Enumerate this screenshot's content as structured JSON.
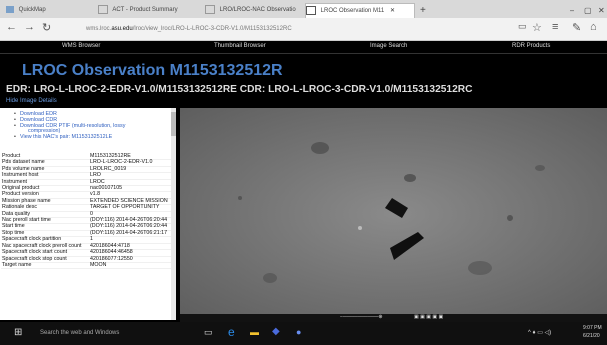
{
  "browser": {
    "tabs": [
      {
        "label": "QuickMap"
      },
      {
        "label": "ACT - Product Summary"
      },
      {
        "label": "LRO/LROC-NAC Observatio"
      },
      {
        "label": "LROC Observation M11"
      }
    ],
    "url_prefix": "wms.lroc.",
    "url_domain": "asu.edu",
    "url_path": "/lroc/view_lroc/LRO-L-LROC-3-CDR-V1.0/M1153132512RC"
  },
  "web_nav": {
    "items": [
      "WMS Browser",
      "Thumbnail Browser",
      "Image Search",
      "RDR Products"
    ]
  },
  "header": {
    "title": "LROC Observation M1153132512R",
    "subtitle": "EDR: LRO-L-LROC-2-EDR-V1.0/M1153132512RE CDR: LRO-L-LROC-3-CDR-V1.0/M1153132512RC",
    "hide_label": "Hide Image Details"
  },
  "links": [
    "Download EDR",
    "Download CDR",
    "Download CDR PTIF (multi-resolution, lossy",
    "compression)",
    "View this NAC's pair: M1153132512LE"
  ],
  "table": [
    [
      "Product",
      "M1153132512RE"
    ],
    [
      "Pds dataset name",
      "LRO-L-LROC-2-EDR-V1.0"
    ],
    [
      "Pds volume name",
      "LROLRC_0019"
    ],
    [
      "Instrument host",
      "LRO"
    ],
    [
      "Instrument",
      "LROC"
    ],
    [
      "Original product",
      "nac00107105"
    ],
    [
      "Product version",
      "v1.8"
    ],
    [
      "Mission phase name",
      "EXTENDED SCIENCE MISSION"
    ],
    [
      "Rationale desc",
      "TARGET OF OPPORTUNITY"
    ],
    [
      "Data quality",
      "0"
    ],
    [
      "Nac preroll start time",
      "(DOY:116) 2014-04-26T06:20:44"
    ],
    [
      "Start time",
      "(DOY:116) 2014-04-26T06:20:44"
    ],
    [
      "Stop time",
      "(DOY:116) 2014-04-26T06:21:17"
    ],
    [
      "Spacecraft clock partition",
      "1"
    ],
    [
      "Nac spacecraft clock preroll count",
      "420186044:4718"
    ],
    [
      "Spacecraft clock start count",
      "420186044:46458"
    ],
    [
      "Spacecraft clock stop count",
      "420186077:12550"
    ],
    [
      "Target name",
      "MOON"
    ]
  ],
  "taskbar": {
    "search_placeholder": "Search the web and Windows",
    "time": "9:07 PM",
    "date": "6/21/20"
  }
}
